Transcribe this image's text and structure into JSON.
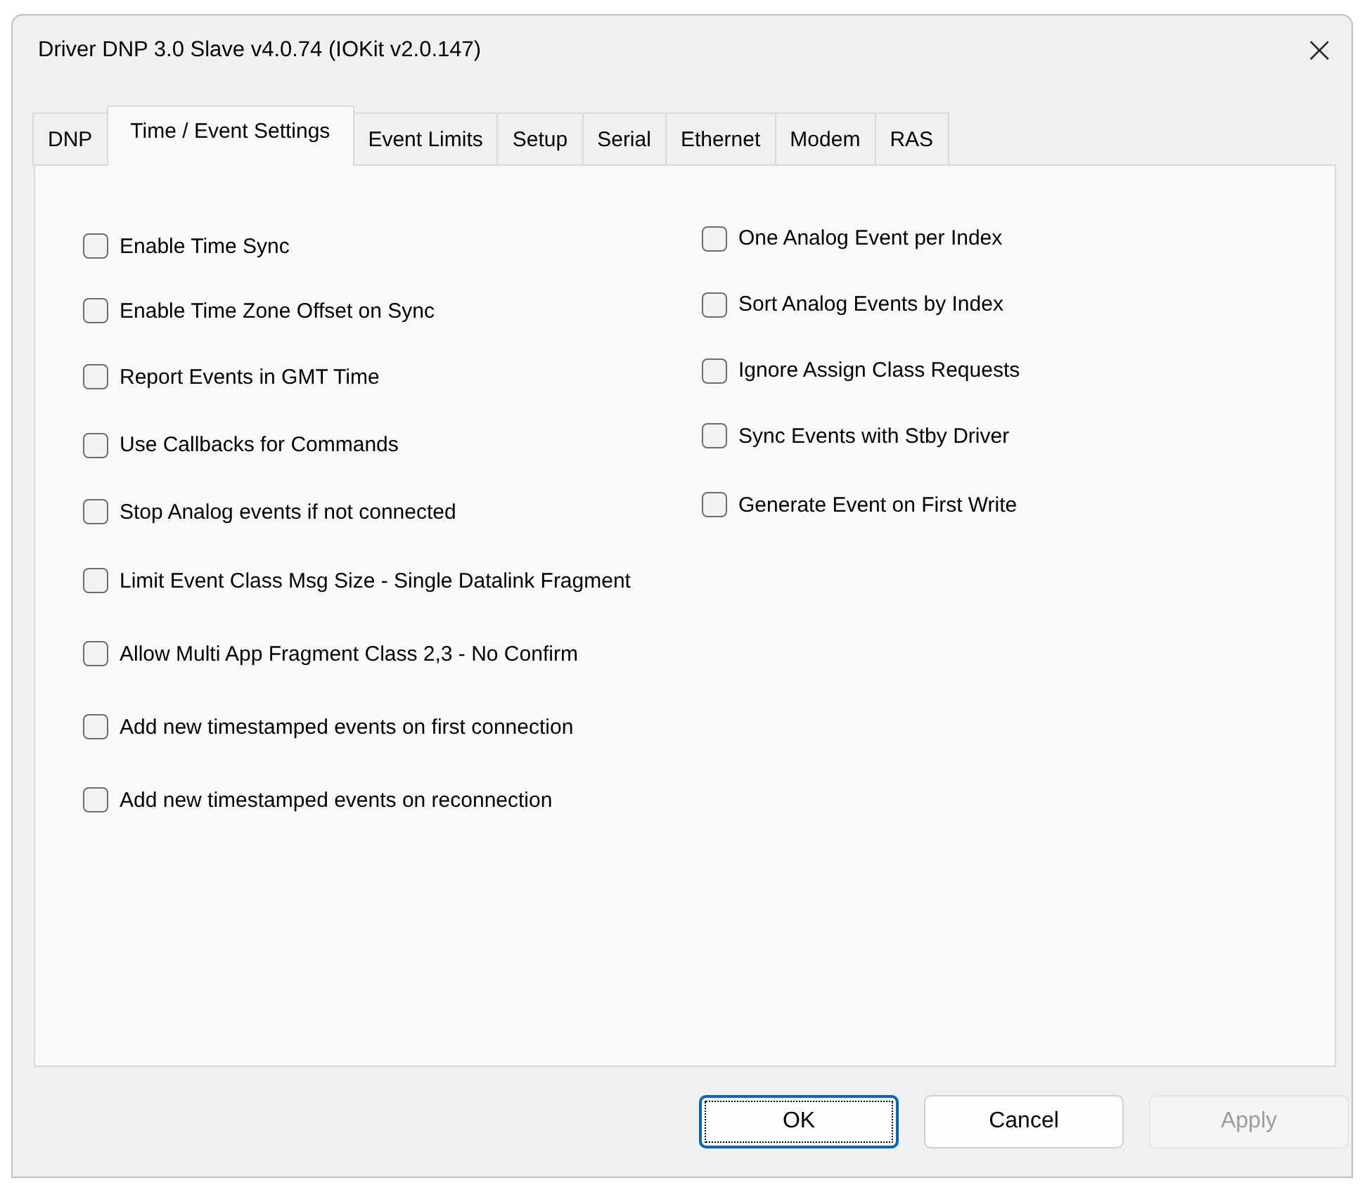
{
  "window": {
    "title": "Driver DNP 3.0 Slave v4.0.74 (IOKit v2.0.147)",
    "close": "×"
  },
  "tabs": [
    {
      "label": "DNP",
      "selected": false
    },
    {
      "label": "Time / Event Settings",
      "selected": true
    },
    {
      "label": "Event Limits",
      "selected": false
    },
    {
      "label": "Setup",
      "selected": false
    },
    {
      "label": "Serial",
      "selected": false
    },
    {
      "label": "Ethernet",
      "selected": false
    },
    {
      "label": "Modem",
      "selected": false
    },
    {
      "label": "RAS",
      "selected": false
    }
  ],
  "left_options": [
    {
      "label": "Enable Time Sync",
      "checked": false
    },
    {
      "label": "Enable Time Zone Offset on Sync",
      "checked": false
    },
    {
      "label": "Report Events in GMT Time",
      "checked": false
    },
    {
      "label": "Use Callbacks for Commands",
      "checked": false
    },
    {
      "label": "Stop Analog events if not connected",
      "checked": false
    }
  ],
  "right_options": [
    {
      "label": "One Analog Event per Index",
      "checked": false
    },
    {
      "label": "Sort Analog Events by Index",
      "checked": false
    },
    {
      "label": "Ignore Assign Class Requests",
      "checked": false
    },
    {
      "label": "Sync Events with Stby Driver",
      "checked": false
    },
    {
      "label": "Generate Event on First Write",
      "checked": false
    }
  ],
  "wide_options": [
    {
      "label": "Limit Event Class Msg Size - Single Datalink Fragment",
      "checked": false
    },
    {
      "label": "Allow Multi App Fragment Class 2,3 - No Confirm",
      "checked": false
    },
    {
      "label": "Add new timestamped events on first connection",
      "checked": false
    },
    {
      "label": "Add new timestamped events on reconnection",
      "checked": false
    }
  ],
  "buttons": [
    {
      "label": "OK",
      "focused": true,
      "disabled": false
    },
    {
      "label": "Cancel",
      "focused": false,
      "disabled": false
    },
    {
      "label": "Apply",
      "focused": false,
      "disabled": true
    }
  ]
}
